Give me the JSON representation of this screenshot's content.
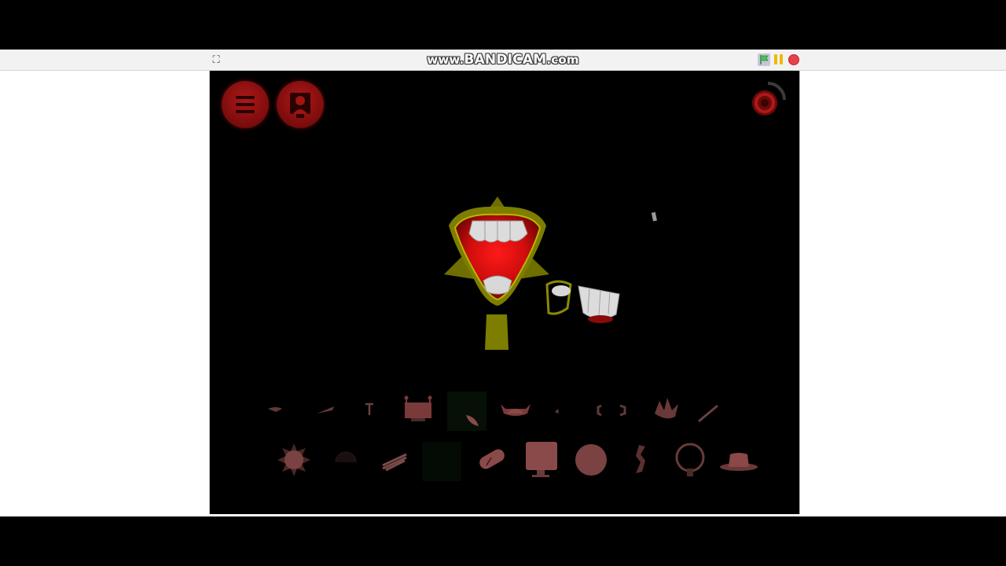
{
  "recorder": {
    "watermark_prefix": "www.",
    "watermark_brand": "BANDICAM",
    "watermark_suffix": ".com"
  },
  "player": {
    "fullscreen_glyph": "⛶",
    "controls": [
      "green-flag",
      "pause",
      "stop"
    ]
  },
  "colors": {
    "button_red": "#9c1414",
    "stage_bg": "#000000",
    "character_yellow": "#8a8a00",
    "mouth_red": "#e01010",
    "teeth": "#d8d8d8",
    "icon_tint": "#6e3b3b",
    "flag_green": "#4cbf56",
    "pause_yellow": "#f0b800",
    "stop_red": "#e8414a"
  },
  "hud": {
    "menu_icon": "hamburger-icon",
    "gallery_icon": "portrait-icon",
    "reset_icon": "reset-icon"
  },
  "toolbar": {
    "row1": [
      "small-wing-icon",
      "slash-icon",
      "antenna-icon",
      "crowned-box-icon",
      "leaf-icon",
      "horned-helmet-icon",
      "dot-icon",
      "bracket-pair-icon",
      "flame-icon",
      "stick-icon"
    ],
    "row2": [
      "spiky-ball-icon",
      "dark-orb-icon",
      "crossed-sticks-icon",
      "empty-slot-icon",
      "capsule-icon",
      "monitor-icon",
      "circle-icon",
      "hook-icon",
      "ring-icon",
      "hat-icon"
    ]
  }
}
